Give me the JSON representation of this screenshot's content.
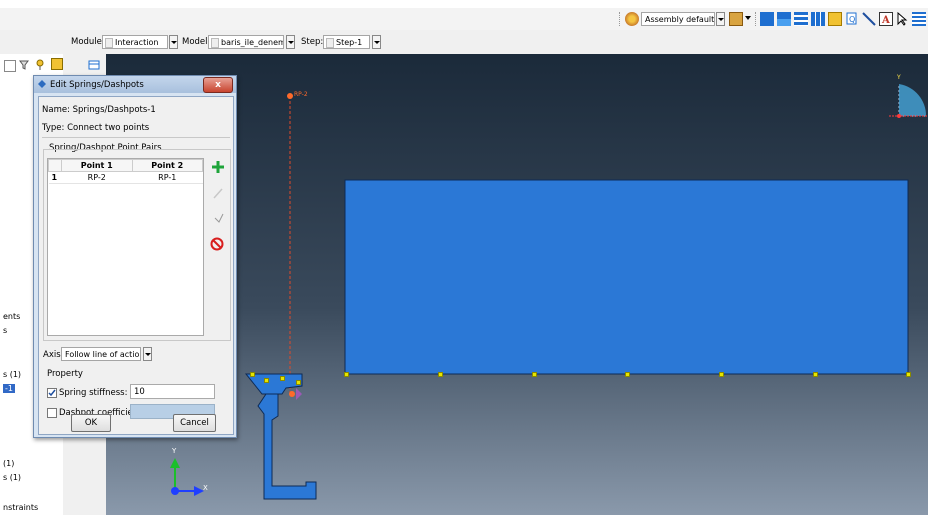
{
  "toolbar": {
    "assembly_label": "Assembly defaults",
    "module_label": "Module:",
    "module_value": "Interaction",
    "model_label": "Model:",
    "model_value": "baris_ile_deneme",
    "step_label": "Step:",
    "step_value": "Step-1"
  },
  "dialog": {
    "title": "Edit Springs/Dashpots",
    "close": "x",
    "name_line": "Name: Springs/Dashpots-1",
    "type_line": "Type:  Connect two points",
    "pairs_group": "Spring/Dashpot Point Pairs",
    "table": {
      "headers": [
        "Point 1",
        "Point 2"
      ],
      "rows": [
        {
          "index": "1",
          "p1": "RP-2",
          "p2": "RP-1"
        }
      ]
    },
    "axis_label": "Axis:",
    "axis_value": "Follow line of action",
    "property_group": "Property",
    "spring_label": "Spring stiffness:",
    "spring_value": "10",
    "dashpot_label": "Dashpot coefficient:",
    "ok": "OK",
    "cancel": "Cancel"
  },
  "tree": {
    "items": [
      "ents",
      "s",
      "s (1)",
      "-1",
      "(1)",
      "s (1)",
      "nstraints"
    ]
  },
  "viewport": {
    "rp_label": "RP-2",
    "triad_y": "Y",
    "triad_x": "X",
    "mini_triad": "Y",
    "colors": {
      "part": "#2b78d6",
      "rp_line": "#e04a2a"
    }
  }
}
